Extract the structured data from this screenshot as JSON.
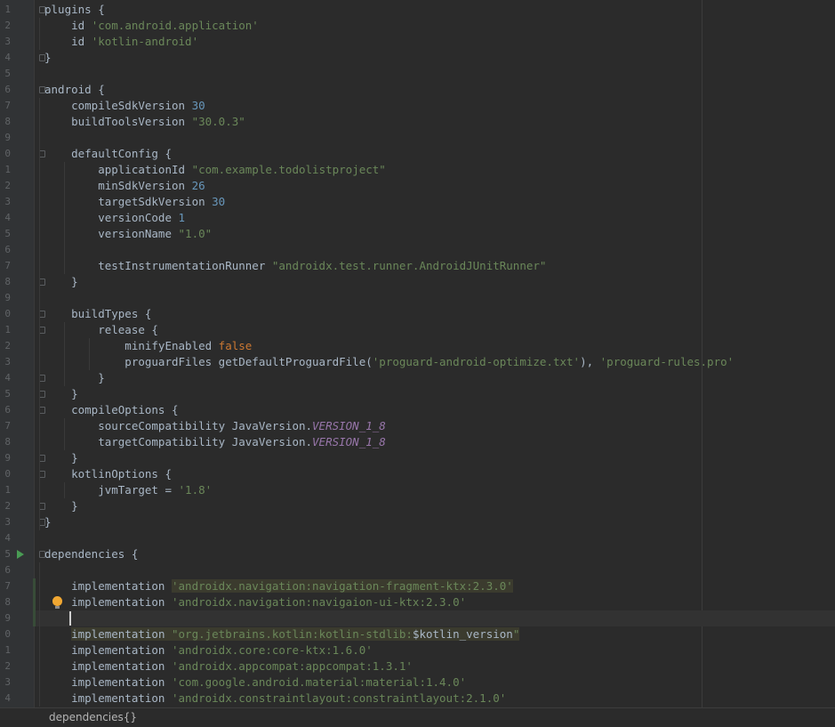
{
  "editor": {
    "lines": [
      {
        "n": "1",
        "segs": [
          {
            "t": "plugins {"
          }
        ]
      },
      {
        "n": "2",
        "segs": [
          {
            "t": "    id "
          },
          {
            "t": "'com.android.application'",
            "c": "str"
          }
        ]
      },
      {
        "n": "3",
        "segs": [
          {
            "t": "    id "
          },
          {
            "t": "'kotlin-android'",
            "c": "str"
          }
        ]
      },
      {
        "n": "4",
        "segs": [
          {
            "t": "}"
          }
        ]
      },
      {
        "n": "5",
        "segs": []
      },
      {
        "n": "6",
        "segs": [
          {
            "t": "android {"
          }
        ]
      },
      {
        "n": "7",
        "segs": [
          {
            "t": "    compileSdkVersion "
          },
          {
            "t": "30",
            "c": "num"
          }
        ]
      },
      {
        "n": "8",
        "segs": [
          {
            "t": "    buildToolsVersion "
          },
          {
            "t": "\"30.0.3\"",
            "c": "str"
          }
        ]
      },
      {
        "n": "9",
        "segs": []
      },
      {
        "n": "0",
        "segs": [
          {
            "t": "    defaultConfig {"
          }
        ]
      },
      {
        "n": "1",
        "segs": [
          {
            "t": "        applicationId "
          },
          {
            "t": "\"com.example.todolistproject\"",
            "c": "str"
          }
        ]
      },
      {
        "n": "2",
        "segs": [
          {
            "t": "        minSdkVersion "
          },
          {
            "t": "26",
            "c": "num"
          }
        ]
      },
      {
        "n": "3",
        "segs": [
          {
            "t": "        targetSdkVersion "
          },
          {
            "t": "30",
            "c": "num"
          }
        ]
      },
      {
        "n": "4",
        "segs": [
          {
            "t": "        versionCode "
          },
          {
            "t": "1",
            "c": "num"
          }
        ]
      },
      {
        "n": "5",
        "segs": [
          {
            "t": "        versionName "
          },
          {
            "t": "\"1.0\"",
            "c": "str"
          }
        ]
      },
      {
        "n": "6",
        "segs": []
      },
      {
        "n": "7",
        "segs": [
          {
            "t": "        testInstrumentationRunner "
          },
          {
            "t": "\"androidx.test.runner.AndroidJUnitRunner\"",
            "c": "str"
          }
        ]
      },
      {
        "n": "8",
        "segs": [
          {
            "t": "    }"
          }
        ]
      },
      {
        "n": "9",
        "segs": []
      },
      {
        "n": "0",
        "segs": [
          {
            "t": "    buildTypes {"
          }
        ]
      },
      {
        "n": "1",
        "segs": [
          {
            "t": "        release {"
          }
        ]
      },
      {
        "n": "2",
        "segs": [
          {
            "t": "            minifyEnabled "
          },
          {
            "t": "false",
            "c": "kw"
          }
        ]
      },
      {
        "n": "3",
        "segs": [
          {
            "t": "            proguardFiles getDefaultProguardFile("
          },
          {
            "t": "'proguard-android-optimize.txt'",
            "c": "str"
          },
          {
            "t": "), "
          },
          {
            "t": "'proguard-rules.pro'",
            "c": "str"
          }
        ]
      },
      {
        "n": "4",
        "segs": [
          {
            "t": "        }"
          }
        ]
      },
      {
        "n": "5",
        "segs": [
          {
            "t": "    }"
          }
        ]
      },
      {
        "n": "6",
        "segs": [
          {
            "t": "    compileOptions {"
          }
        ]
      },
      {
        "n": "7",
        "segs": [
          {
            "t": "        sourceCompatibility JavaVersion."
          },
          {
            "t": "VERSION_1_8",
            "c": "ital"
          }
        ]
      },
      {
        "n": "8",
        "segs": [
          {
            "t": "        targetCompatibility JavaVersion."
          },
          {
            "t": "VERSION_1_8",
            "c": "ital"
          }
        ]
      },
      {
        "n": "9",
        "segs": [
          {
            "t": "    }"
          }
        ]
      },
      {
        "n": "0",
        "segs": [
          {
            "t": "    kotlinOptions {"
          }
        ]
      },
      {
        "n": "1",
        "segs": [
          {
            "t": "        jvmTarget = "
          },
          {
            "t": "'1.8'",
            "c": "str"
          }
        ]
      },
      {
        "n": "2",
        "segs": [
          {
            "t": "    }"
          }
        ]
      },
      {
        "n": "3",
        "segs": [
          {
            "t": "}"
          }
        ]
      },
      {
        "n": "4",
        "segs": []
      },
      {
        "n": "5",
        "segs": [
          {
            "t": "dependencies {"
          }
        ]
      },
      {
        "n": "6",
        "segs": []
      },
      {
        "n": "7",
        "segs": [
          {
            "t": "    implementation "
          },
          {
            "t": "'androidx.navigation:navigation-fragment-ktx:2.3.0'",
            "c": "str hl"
          }
        ]
      },
      {
        "n": "8",
        "segs": [
          {
            "t": "    implementation "
          },
          {
            "t": "'androidx.navigation:navigaion-ui-ktx:2.3.0'",
            "c": "str"
          }
        ]
      },
      {
        "n": "9",
        "segs": []
      },
      {
        "n": "0",
        "segs": [
          {
            "t": "    "
          },
          {
            "t": "implementation ",
            "c": "hl"
          },
          {
            "t": "\"org.jetbrains.kotlin:kotlin-stdlib:",
            "c": "str hl"
          },
          {
            "t": "$kotlin_version",
            "c": "hl"
          },
          {
            "t": "\"",
            "c": "str hl"
          }
        ]
      },
      {
        "n": "1",
        "segs": [
          {
            "t": "    implementation "
          },
          {
            "t": "'androidx.core:core-ktx:1.6.0'",
            "c": "str"
          }
        ]
      },
      {
        "n": "2",
        "segs": [
          {
            "t": "    implementation "
          },
          {
            "t": "'androidx.appcompat:appcompat:1.3.1'",
            "c": "str"
          }
        ]
      },
      {
        "n": "3",
        "segs": [
          {
            "t": "    implementation "
          },
          {
            "t": "'com.google.android.material:material:1.4.0'",
            "c": "str"
          }
        ]
      },
      {
        "n": "4",
        "segs": [
          {
            "t": "    implementation "
          },
          {
            "t": "'androidx.constraintlayout:constraintlayout:2.1.0'",
            "c": "str"
          }
        ]
      }
    ],
    "current_line": "9"
  },
  "breadcrumb": {
    "label": "dependencies{}"
  },
  "colors": {
    "background": "#2b2b2b",
    "text": "#a9b7c6",
    "string": "#6a8759",
    "number": "#6897bb",
    "keyword": "#cc7832",
    "constant": "#9876aa"
  }
}
